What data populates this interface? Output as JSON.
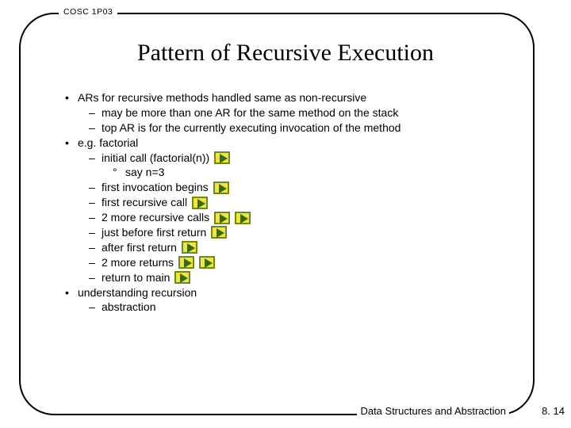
{
  "course_tag": "COSC 1P03",
  "title": "Pattern of Recursive Execution",
  "bullets": {
    "b1": "ARs for recursive methods handled same as non-recursive",
    "b1a": "may be more than one AR for the same method on the stack",
    "b1b": "top AR is for the currently executing invocation of the method",
    "b2": "e.g. factorial",
    "b2a": "initial call (factorial(n))",
    "b2a1": "say n=3",
    "b2b": "first invocation begins",
    "b2c": "first recursive call",
    "b2d": "2 more recursive calls",
    "b2e": "just before first return",
    "b2f": "after first return",
    "b2g": "2 more returns",
    "b2h": "return to main",
    "b3": "understanding recursion",
    "b3a": "abstraction"
  },
  "footer": "Data Structures and Abstraction",
  "page": "8. 14"
}
